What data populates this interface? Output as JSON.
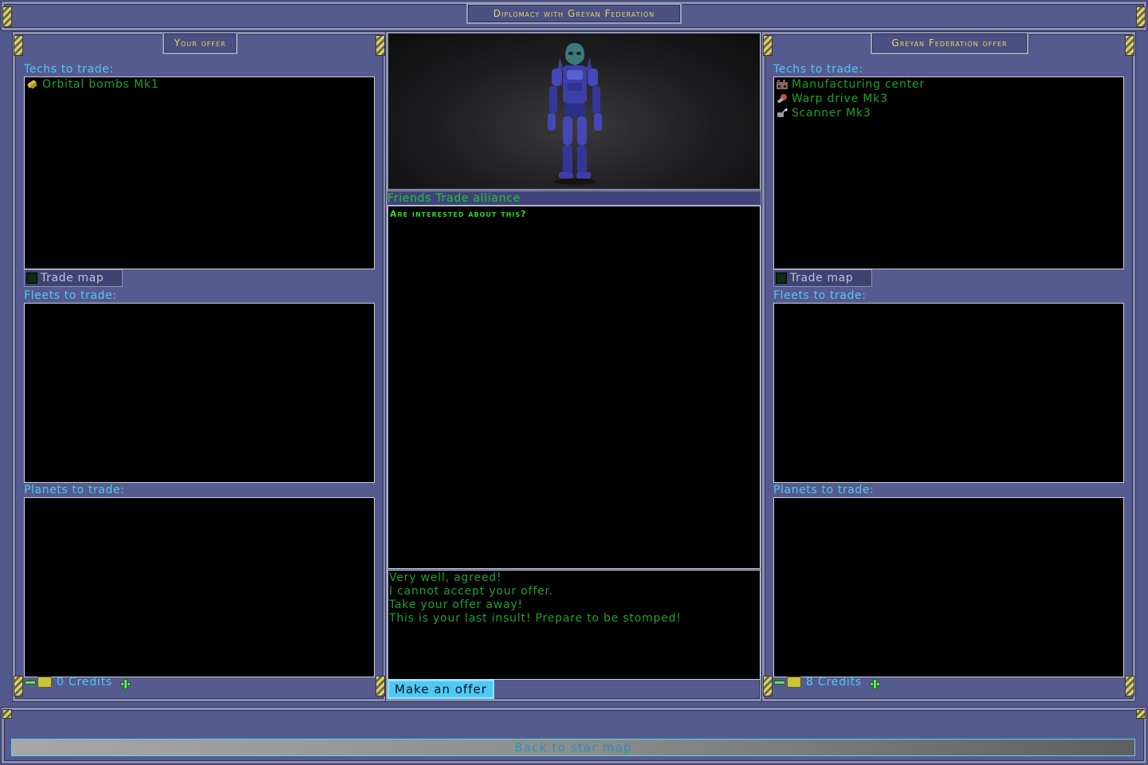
{
  "window_title": "Diplomacy with Greyan Federation",
  "left_panel": {
    "header": "Your offer",
    "techs_label": "Techs to trade:",
    "techs": [
      {
        "name": "Orbital bombs Mk1",
        "icon": "bomb-icon"
      }
    ],
    "trade_map_label": "Trade map",
    "fleets_label": "Fleets to trade:",
    "planets_label": "Planets to trade:",
    "credits": "0 Credits"
  },
  "right_panel": {
    "header": "Greyan Federation offer",
    "techs_label": "Techs to trade:",
    "techs": [
      {
        "name": "Manufacturing center",
        "icon": "factory-icon"
      },
      {
        "name": "Warp drive Mk3",
        "icon": "warp-drive-icon"
      },
      {
        "name": "Scanner Mk3",
        "icon": "scanner-icon"
      }
    ],
    "trade_map_label": "Trade map",
    "fleets_label": "Fleets to trade:",
    "planets_label": "Planets to trade:",
    "credits": "8 Credits"
  },
  "center": {
    "status": "Friends Trade alliance",
    "question": "Are interested about this?",
    "responses": [
      "Very well, agreed!",
      "I cannot accept your offer.",
      "Take your offer away!",
      "This is your last insult! Prepare to be stomped!"
    ],
    "make_offer_label": "Make an offer"
  },
  "footer": {
    "back_label": "Back to star map"
  },
  "colors": {
    "panel": "#555b8e",
    "label_cyan": "#4fc8f4",
    "text_green": "#1fa12b",
    "title_gold": "#e7d45d"
  }
}
